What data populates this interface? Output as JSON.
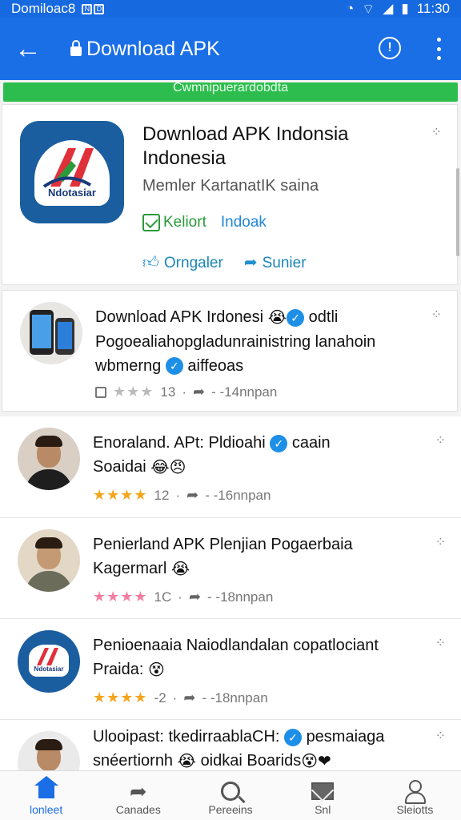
{
  "status_bar": {
    "carrier": "Domiloac8",
    "time": "11:30"
  },
  "app_bar": {
    "title": "Download APK"
  },
  "banner": {
    "text": "Cwmnipuerardobdta"
  },
  "app_card": {
    "title": "Download APK Indonsia Indonesia",
    "subtitle": "Memler KartanatIK saina",
    "logo_text": "Ndotasiar",
    "kelport_label": "Keliort",
    "indoak_label": "Indoak",
    "orngaler_label": "Orngaler",
    "sunier_label": "Sunier"
  },
  "posts": [
    {
      "text_main": "Download APK Irdonesi",
      "text_after": "odtli",
      "line2": "Pogoealiahopgladunrainistring lanahoin",
      "line3a": "wbmerng",
      "line3b": "aiffeoas",
      "rating_count": "13",
      "time": "- -14nnpan"
    },
    {
      "text_main": "Enoraland. APt: Pldioahi",
      "text_after": "caain",
      "line2": "Soaidai",
      "rating_count": "12",
      "time": "- -16nnpan"
    },
    {
      "text_main": "Penierland APK Plenjian Pogaerbaia",
      "line2": "Kagermarl",
      "rating_count": "1C",
      "time": "- -18nnpan"
    },
    {
      "text_main": "Penioenaaia Naiodlandalan copatlociant",
      "line2": "Praida:",
      "rating_count": "-2",
      "time": "- -18nnpan",
      "logo_text": "Ndotasiar"
    },
    {
      "text_main": "Ulooipast: tkedirraablaCH:",
      "text_after": "pesmaiaga",
      "line2a": "snéertiornh",
      "line2b": "oidkai Boarids"
    }
  ],
  "bottom_nav": [
    {
      "label": "lonleet",
      "icon": "home-icon"
    },
    {
      "label": "Canades",
      "icon": "share-arrow-icon"
    },
    {
      "label": "Pereeins",
      "icon": "search-icon"
    },
    {
      "label": "Snl",
      "icon": "mail-icon"
    },
    {
      "label": "Sleiotts",
      "icon": "profile-icon"
    }
  ],
  "colors": {
    "primary": "#1a6ee6",
    "green": "#2cbd4e",
    "star": "#f4a51c"
  }
}
